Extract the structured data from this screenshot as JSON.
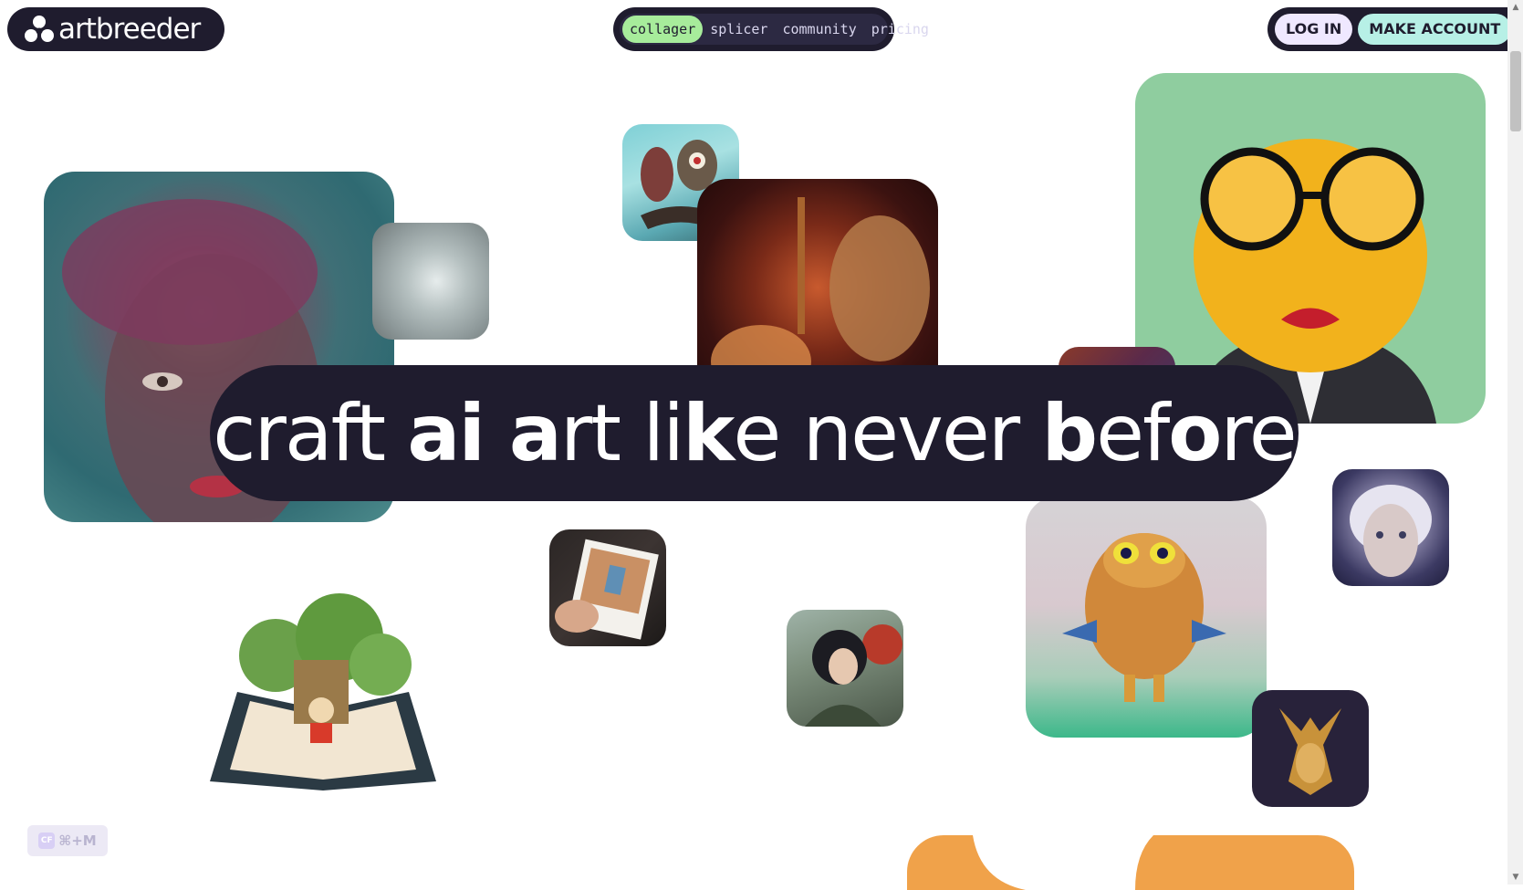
{
  "brand": {
    "name": "artbreeder"
  },
  "nav": {
    "items": [
      {
        "label": "collager",
        "active": true
      },
      {
        "label": "splicer",
        "active": false
      },
      {
        "label": "community",
        "active": false
      },
      {
        "label": "pricing",
        "active": false
      }
    ]
  },
  "auth": {
    "login_label": "LOG IN",
    "signup_label": "MAKE ACCOUNT"
  },
  "hero": {
    "part1": "craft ",
    "part2": "ai a",
    "part3": "rt li",
    "part4": "k",
    "part5": "e never ",
    "part6": "b",
    "part7": "ef",
    "part8": "o",
    "part9": "re"
  },
  "shortcut": {
    "badge": "CF",
    "keys": "⌘+M"
  },
  "colors": {
    "dark": "#1f1c2e",
    "accent_green": "#a7ec9b",
    "accent_lavender": "#efe8ff",
    "accent_mint": "#b7f0e6"
  }
}
